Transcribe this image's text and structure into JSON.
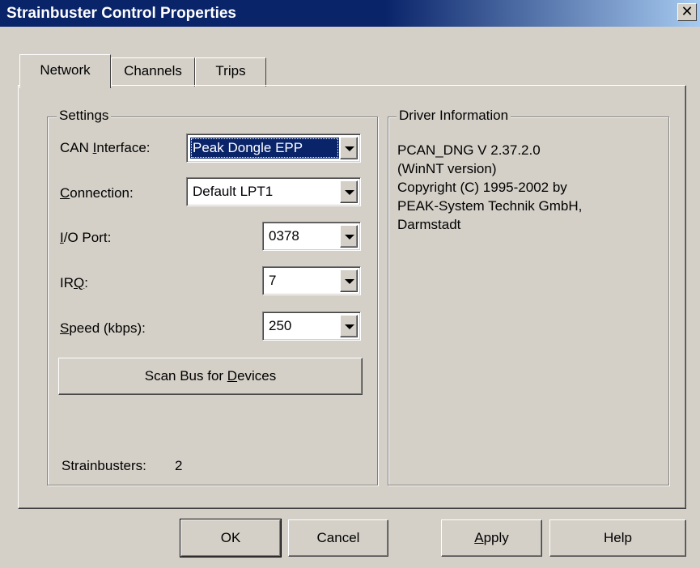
{
  "window": {
    "title": "Strainbuster Control Properties",
    "close_glyph": "✕"
  },
  "tabs": [
    {
      "label": "Network",
      "active": true
    },
    {
      "label": "Channels",
      "active": false
    },
    {
      "label": "Trips",
      "active": false
    }
  ],
  "settings": {
    "legend": "Settings",
    "can_interface": {
      "label_pre": "CAN ",
      "label_u": "I",
      "label_post": "nterface:",
      "value": "Peak Dongle EPP"
    },
    "connection": {
      "label_pre": "",
      "label_u": "C",
      "label_post": "onnection:",
      "value": "Default LPT1"
    },
    "io_port": {
      "label_pre": "",
      "label_u": "I",
      "label_post": "/O Port:",
      "value": "0378"
    },
    "irq": {
      "label_pre": "IR",
      "label_u": "Q",
      "label_post": ":",
      "value": "7"
    },
    "speed": {
      "label_pre": "",
      "label_u": "S",
      "label_post": "peed (kbps):",
      "value": "250"
    },
    "scan_button": {
      "label_pre": "Scan Bus for ",
      "label_u": "D",
      "label_post": "evices"
    },
    "strainbusters_label": "Strainbusters:",
    "strainbusters_count": "2"
  },
  "driver_info": {
    "legend": "Driver Information",
    "lines": [
      "PCAN_DNG V 2.37.2.0",
      "(WinNT version)",
      "Copyright (C)  1995-2002 by",
      "PEAK-System Technik GmbH,",
      "Darmstadt"
    ]
  },
  "buttons": {
    "ok": "OK",
    "cancel": "Cancel",
    "apply_u": "A",
    "apply_post": "pply",
    "help": "Help"
  },
  "colors": {
    "titlebar": "#0a246a",
    "face": "#d4d0c8",
    "selection": "#0a246a"
  }
}
